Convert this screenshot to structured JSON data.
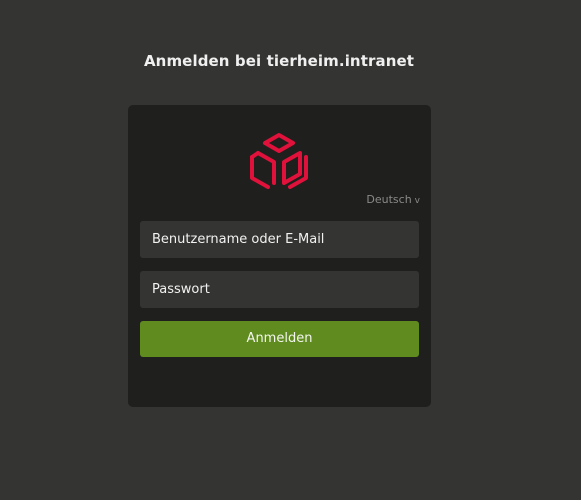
{
  "header": {
    "title": "Anmelden bei tierheim.intranet"
  },
  "login": {
    "logo_icon": "cube-logo-icon",
    "logo_color": "#e0113a",
    "language": "Deutsch",
    "language_chevron": "v",
    "username_placeholder": "Benutzername oder E-Mail",
    "password_placeholder": "Passwort",
    "submit_label": "Anmelden",
    "submit_color": "#5f8b1f"
  }
}
